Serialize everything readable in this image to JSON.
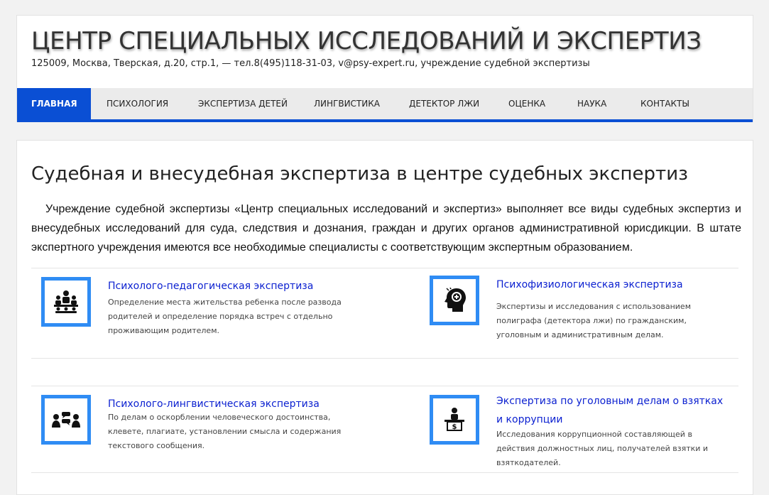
{
  "header": {
    "title": "ЦЕНТР СПЕЦИАЛЬНЫХ ИССЛЕДОВАНИЙ И ЭКСПЕРТИЗ",
    "description": "125009, Москва, Тверская, д.20, стр.1, — тел.8(495)118-31-03, v@psy-expert.ru, учреждение судебной экспертизы"
  },
  "nav": {
    "items": [
      {
        "label": "ГЛАВНАЯ",
        "active": true
      },
      {
        "label": "ПСИХОЛОГИЯ"
      },
      {
        "label": "ЭКСПЕРТИЗА ДЕТЕЙ"
      },
      {
        "label": "ЛИНГВИСТИКА"
      },
      {
        "label": "ДЕТЕКТОР ЛЖИ"
      },
      {
        "label": "ОЦЕНКА"
      },
      {
        "label": "НАУКА"
      },
      {
        "label": "КОНТАКТЫ"
      }
    ]
  },
  "main": {
    "title": "Судебная и внесудебная экспертиза в центре судебных экспертиз",
    "intro": "Учреждение судебной экспертизы «Центр специальных исследований и экспертиз» выполняет все виды судебных экспертиз и внесудебных исследований для суда, следствия и дознания, граждан и других органов административной юрисдикции. В штате экспертного учреждения имеются все необходимые специалисты с соответствующим экспертным образованием.",
    "services": [
      {
        "title": "Психолого-педагогическая экспертиза",
        "text": "Определение места жительства ребенка после развода родителей и определение порядка встреч с отдельно проживающим родителем.",
        "icon": "family-meeting-icon"
      },
      {
        "title": "Психофизиологическая экспертиза",
        "text": "Экспертизы и исследования с использованием полиграфа (детектора лжи) по гражданским, уголовным и административным делам.",
        "icon": "head-brain-icon"
      },
      {
        "title": "Психолого-лингвистическая экспертиза",
        "text": "По делам о оскорблении человеческого достоинства, клевете, плагиате, установлении смысла и содержания текстового сообщения.",
        "icon": "people-dialogue-icon"
      },
      {
        "title": "Экспертиза по уголовным делам о взятках и коррупции",
        "text": "Исследования коррупционной составляющей в действия должностных лиц, получателей взятки и взяткодателей.",
        "icon": "bribe-desk-icon"
      }
    ]
  },
  "colors": {
    "accent": "#0a4fd4",
    "icon_border": "#2f8cf4",
    "link": "#0a1fd0"
  }
}
